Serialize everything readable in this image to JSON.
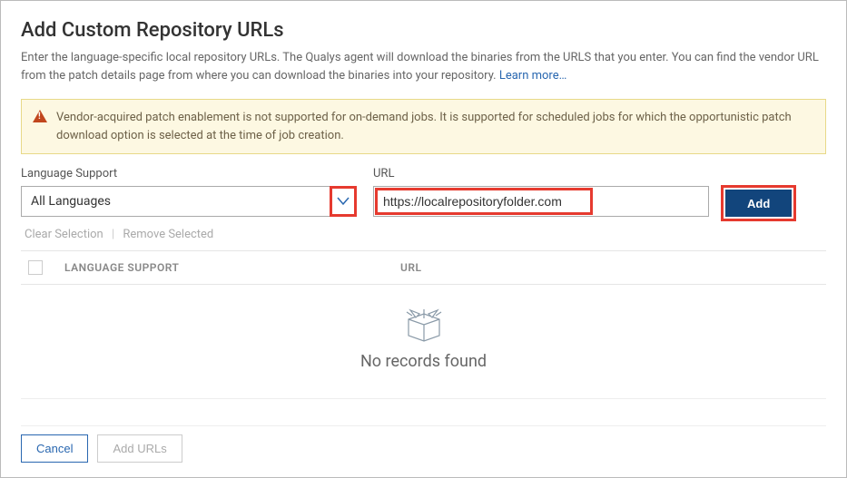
{
  "title": "Add Custom Repository URLs",
  "subtitle_part1": "Enter the language-specific local repository URLs. The Qualys agent will download the binaries from the URLS that you enter. You can find the vendor URL from the patch details page from where you can download the binaries into your repository. ",
  "learn_more": "Learn more…",
  "alert_text": "Vendor-acquired patch enablement is not supported for on-demand jobs. It is supported for scheduled jobs for which the opportunistic patch download option is selected at the time of job creation.",
  "fields": {
    "language_label": "Language Support",
    "language_value": "All Languages",
    "url_label": "URL",
    "url_value": "https://localrepositoryfolder.com"
  },
  "add_button": "Add",
  "actions": {
    "clear": "Clear Selection",
    "remove": "Remove Selected"
  },
  "table": {
    "col_language": "LANGUAGE SUPPORT",
    "col_url": "URL",
    "empty": "No records found"
  },
  "footer": {
    "cancel": "Cancel",
    "add_urls": "Add URLs"
  },
  "colors": {
    "highlight": "#e63a2f",
    "primary": "#12457c",
    "link": "#2967b0"
  }
}
